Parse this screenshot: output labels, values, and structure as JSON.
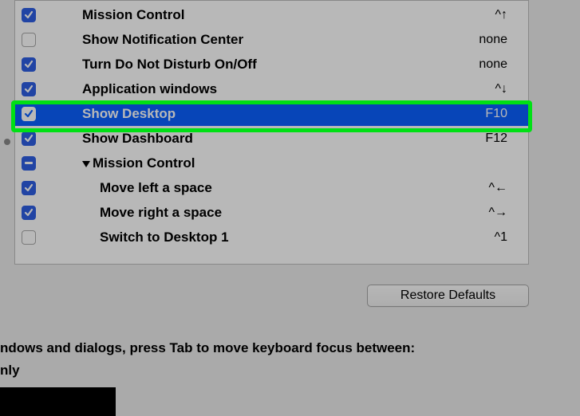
{
  "rows": [
    {
      "id": "mission-control",
      "checked": "checked",
      "label": "Mission Control",
      "shortcut": "^↑",
      "dim": false,
      "indent": 1
    },
    {
      "id": "show-notification-center",
      "checked": "unchecked",
      "label": "Show Notification Center",
      "shortcut": "none",
      "dim": true,
      "indent": 1
    },
    {
      "id": "turn-dnd",
      "checked": "checked",
      "label": "Turn Do Not Disturb On/Off",
      "shortcut": "none",
      "dim": true,
      "indent": 1
    },
    {
      "id": "application-windows",
      "checked": "checked",
      "label": "Application windows",
      "shortcut": "^↓",
      "dim": false,
      "indent": 1
    },
    {
      "id": "show-desktop",
      "checked": "checked-white",
      "label": "Show Desktop",
      "shortcut": "F10",
      "dim": false,
      "indent": 1,
      "selected": true
    },
    {
      "id": "show-dashboard",
      "checked": "checked",
      "label": "Show Dashboard",
      "shortcut": "F12",
      "dim": false,
      "indent": 1
    },
    {
      "id": "mc-group",
      "checked": "mixed",
      "label": "Mission Control",
      "shortcut": "",
      "dim": false,
      "group": true
    },
    {
      "id": "move-left",
      "checked": "checked",
      "label": "Move left a space",
      "shortcut": "^←",
      "dim": false,
      "indent": 2
    },
    {
      "id": "move-right",
      "checked": "checked",
      "label": "Move right a space",
      "shortcut": "^→",
      "dim": false,
      "indent": 2
    },
    {
      "id": "switch-desktop-1",
      "checked": "unchecked",
      "label": "Switch to Desktop 1",
      "shortcut": "^1",
      "dim": false,
      "indent": 2
    }
  ],
  "buttons": {
    "restore": "Restore Defaults"
  },
  "footer": {
    "line1": "ndows and dialogs, press Tab to move keyboard focus between:",
    "line2": "nly"
  }
}
